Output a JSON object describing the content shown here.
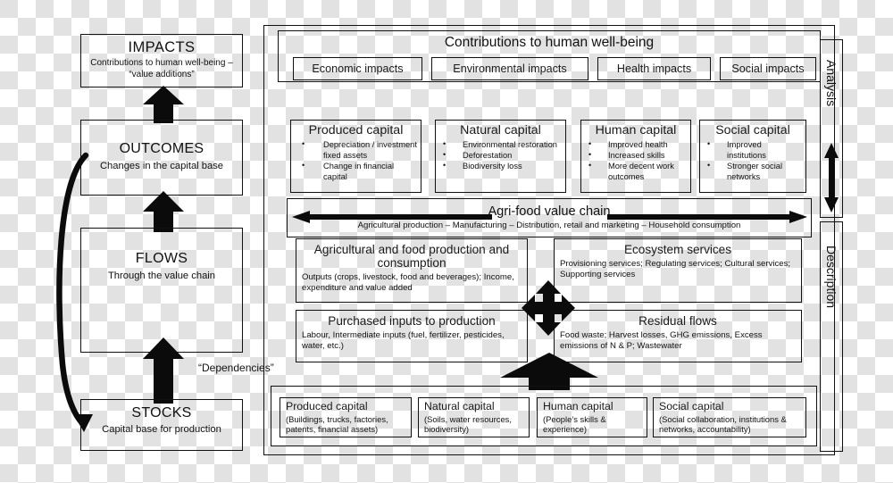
{
  "left_column": {
    "impacts": {
      "title": "IMPACTS",
      "subtitle": "Contributions to human well-being – “value additions”"
    },
    "outcomes": {
      "title": "OUTCOMES",
      "subtitle": "Changes in the capital base"
    },
    "flows": {
      "title": "FLOWS",
      "subtitle": "Through the value chain"
    },
    "stocks": {
      "title": "STOCKS",
      "subtitle": "Capital base for production"
    },
    "dependencies_label": "“Dependencies”"
  },
  "contributions": {
    "title": "Contributions to human well-being",
    "impacts": [
      "Economic impacts",
      "Environmental impacts",
      "Health impacts",
      "Social impacts"
    ]
  },
  "capital_outcomes": [
    {
      "title": "Produced capital",
      "items": [
        "Depreciation / investment fixed assets",
        "Change in financial capital"
      ]
    },
    {
      "title": "Natural capital",
      "items": [
        "Environmental restoration",
        "Deforestation",
        "Biodiversity loss"
      ]
    },
    {
      "title": "Human capital",
      "items": [
        "Improved health",
        "Increased skills",
        "More decent work outcomes"
      ]
    },
    {
      "title": "Social capital",
      "items": [
        "Improved institutions",
        "Stronger social networks"
      ]
    }
  ],
  "value_chain": {
    "title": "Agri-food value chain",
    "subtitle": "Agricultural production – Manufacturing – Distribution, retail and marketing – Household consumption"
  },
  "flow_boxes": {
    "agri_food": {
      "title": "Agricultural and food production and consumption",
      "subtitle": "Outputs (crops, livestock, food and beverages); Income, expenditure and value added"
    },
    "ecosystem": {
      "title": "Ecosystem services",
      "subtitle": "Provisioning services; Regulating services; Cultural services; Supporting services"
    },
    "purchased_inputs": {
      "title": "Purchased inputs to production",
      "subtitle": "Labour, Intermediate inputs (fuel, fertilizer, pesticides, water, etc.)"
    },
    "residual_flows": {
      "title": "Residual flows",
      "subtitle": "Food waste; Harvest losses, GHG emissions, Excess emissions of N & P; Wastewater"
    }
  },
  "capital_stocks": [
    {
      "title": "Produced capital",
      "subtitle": "(Buildings, trucks, factories, patents, financial assets)"
    },
    {
      "title": "Natural capital",
      "subtitle": "(Soils, water resources, biodiversity)"
    },
    {
      "title": "Human capital",
      "subtitle": "(People’s skills & experience)"
    },
    {
      "title": "Social capital",
      "subtitle": "(Social collaboration, institutions & networks, accountability)"
    }
  ],
  "axis_labels": {
    "analysis": "Analysis",
    "description": "Description"
  },
  "colors": {
    "line": "#111111",
    "arrow": "#0b0b0b",
    "text": "#1a1a1a"
  }
}
